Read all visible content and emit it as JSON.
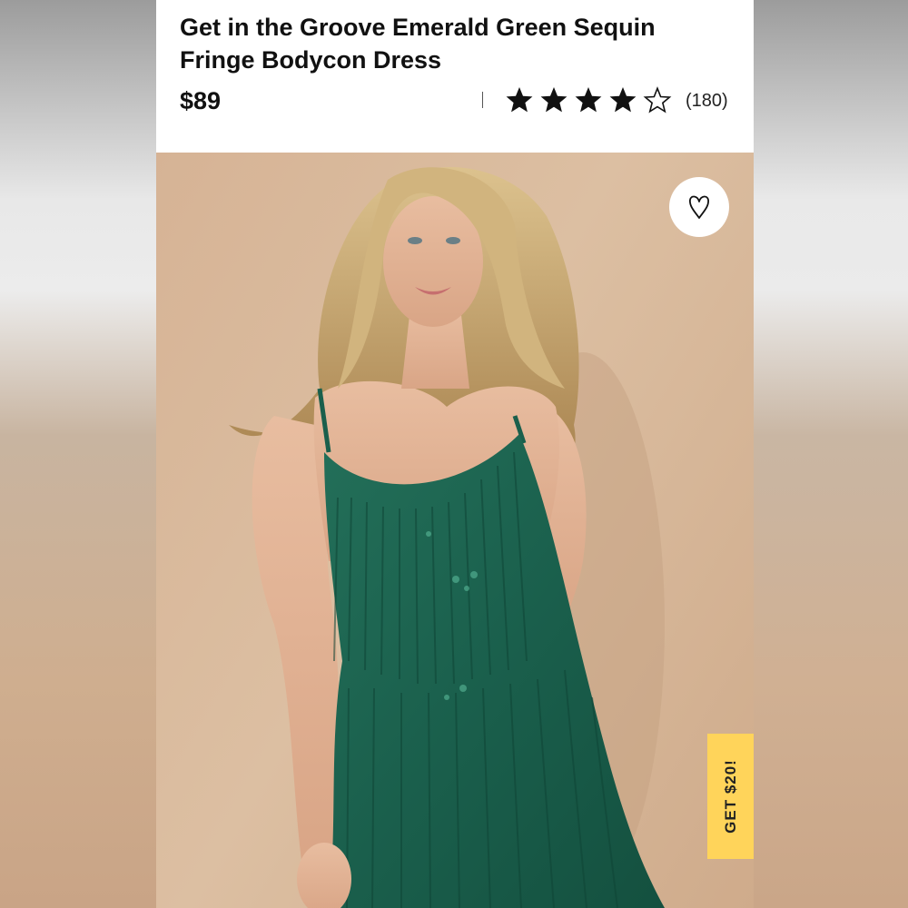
{
  "product": {
    "title": "Get in the Groove Emerald Green Sequin Fringe Bodycon Dress",
    "price": "$89",
    "rating": 4,
    "rating_max": 5,
    "review_count": "(180)"
  },
  "image": {
    "subject": "model in emerald green sequin fringe dress",
    "colors": {
      "backdrop": "#d8b698",
      "dress": "#1d6a55",
      "hair": "#c9a36a"
    }
  },
  "actions": {
    "favorite_icon": "heart-icon",
    "promo_label": "GET $20!",
    "promo_color": "#ffd45a"
  }
}
